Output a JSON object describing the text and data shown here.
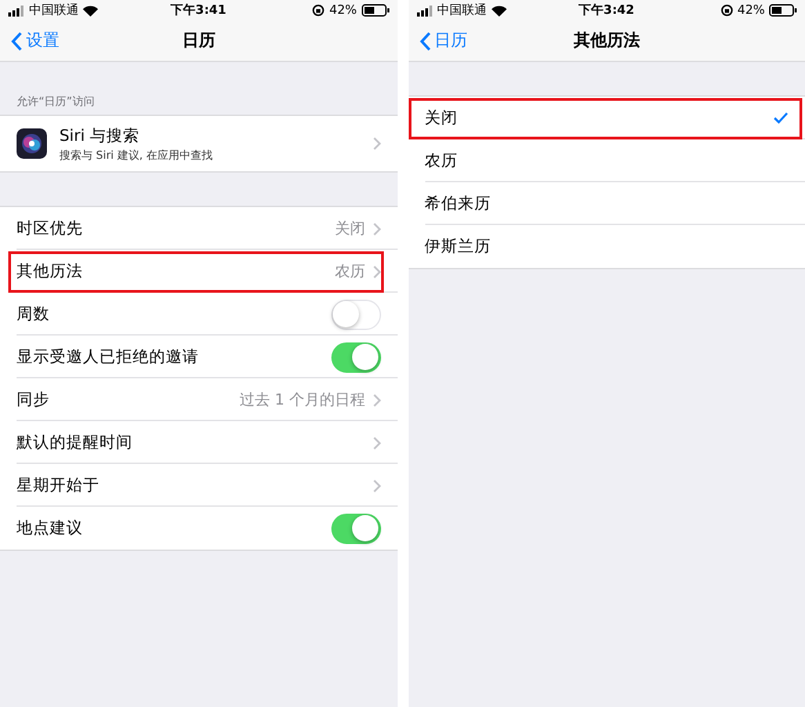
{
  "screens": [
    {
      "status_bar": {
        "carrier": "中国联通",
        "time": "下午3:41",
        "battery": "42%"
      },
      "nav": {
        "back": "设置",
        "title": "日历"
      },
      "sections": [
        {
          "header": "允许“日历”访问",
          "rows": [
            {
              "kind": "app",
              "label": "Siri 与搜索",
              "subtitle": "搜索与 Siri 建议, 在应用中查找",
              "highlighted": false
            }
          ]
        },
        {
          "rows": [
            {
              "kind": "link",
              "label": "时区优先",
              "value": "关闭",
              "highlighted": false
            },
            {
              "kind": "link",
              "label": "其他历法",
              "value": "农历",
              "highlighted": true
            },
            {
              "kind": "toggle",
              "label": "周数",
              "on": false,
              "highlighted": false
            },
            {
              "kind": "toggle",
              "label": "显示受邀人已拒绝的邀请",
              "on": true,
              "highlighted": false
            },
            {
              "kind": "link",
              "label": "同步",
              "value": "过去 1 个月的日程",
              "highlighted": false
            },
            {
              "kind": "link",
              "label": "默认的提醒时间",
              "highlighted": false
            },
            {
              "kind": "link",
              "label": "星期开始于",
              "highlighted": false
            },
            {
              "kind": "toggle",
              "label": "地点建议",
              "on": true,
              "highlighted": false
            }
          ]
        }
      ]
    },
    {
      "status_bar": {
        "carrier": "中国联通",
        "time": "下午3:42",
        "battery": "42%"
      },
      "nav": {
        "back": "日历",
        "title": "其他历法"
      },
      "sections": [
        {
          "rows": [
            {
              "kind": "option",
              "label": "关闭",
              "selected": true,
              "highlighted": true
            },
            {
              "kind": "option",
              "label": "农历",
              "selected": false,
              "highlighted": false
            },
            {
              "kind": "option",
              "label": "希伯来历",
              "selected": false,
              "highlighted": false
            },
            {
              "kind": "option",
              "label": "伊斯兰历",
              "selected": false,
              "highlighted": false
            }
          ]
        }
      ]
    }
  ]
}
